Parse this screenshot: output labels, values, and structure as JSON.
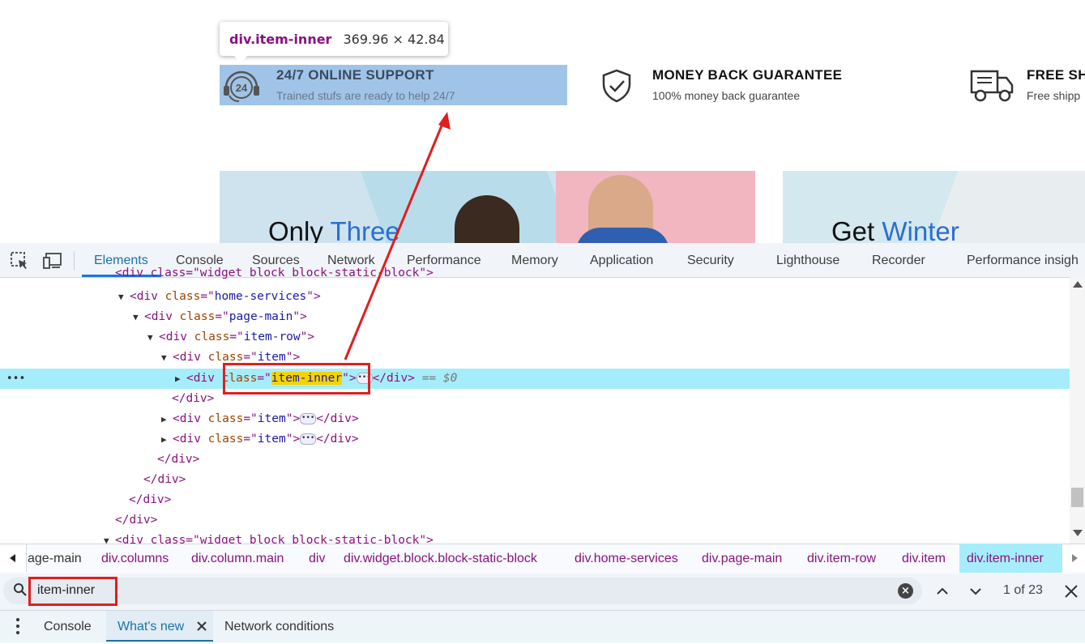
{
  "tooltip": {
    "element": "div.item-inner",
    "size": "369.96 × 42.84"
  },
  "services": [
    {
      "title": "24/7 ONLINE SUPPORT",
      "subtitle": "Trained stufs are ready to help 24/7",
      "icon": "headset-24-icon"
    },
    {
      "title": "MONEY BACK GUARANTEE",
      "subtitle": "100% money back guarantee",
      "icon": "shield-check-icon"
    },
    {
      "title": "FREE SH",
      "subtitle": "Free shipp",
      "icon": "delivery-truck-icon"
    }
  ],
  "banners": [
    {
      "plain": "Only ",
      "accent": "Three"
    },
    {
      "plain": "Get ",
      "accent": "Winter"
    }
  ],
  "devtools": {
    "tabs": [
      "Elements",
      "Console",
      "Sources",
      "Network",
      "Performance",
      "Memory",
      "Application",
      "Security",
      "Lighthouse",
      "Recorder",
      "Performance insigh"
    ],
    "active_tab": "Elements",
    "dom": {
      "r0": "<div class=\"widget block block-static-block\">",
      "home_services": {
        "tag": "div",
        "attr": "class",
        "val": "home-services"
      },
      "page_main": {
        "tag": "div",
        "attr": "class",
        "val": "page-main"
      },
      "item_row": {
        "tag": "div",
        "attr": "class",
        "val": "item-row"
      },
      "item": {
        "tag": "div",
        "attr": "class",
        "val": "item"
      },
      "item_inner": {
        "tag": "div",
        "attr": "class",
        "val": "item-inner",
        "close": "</div>",
        "marker": "== $0"
      },
      "close_div": "</div>",
      "item2": {
        "tag": "div",
        "attr": "class",
        "val": "item",
        "close": "</div>"
      },
      "item3": {
        "tag": "div",
        "attr": "class",
        "val": "item",
        "close": "</div>"
      },
      "last": "<div class=\"widget block block-static-block\">"
    },
    "breadcrumbs": [
      "age-main",
      "div.columns",
      "div.column.main",
      "div",
      "div.widget.block.block-static-block",
      "div.home-services",
      "div.page-main",
      "div.item-row",
      "div.item",
      "div.item-inner"
    ],
    "search": {
      "value": "item-inner",
      "count": "1 of 23"
    },
    "drawer_tabs": [
      "Console",
      "What's new",
      "Network conditions"
    ]
  },
  "colors": {
    "highlight": "#a0c4e8",
    "selected_row": "#a6edfb",
    "annotation_red": "#e01e1e",
    "accent_blue": "#2a6fd0"
  }
}
